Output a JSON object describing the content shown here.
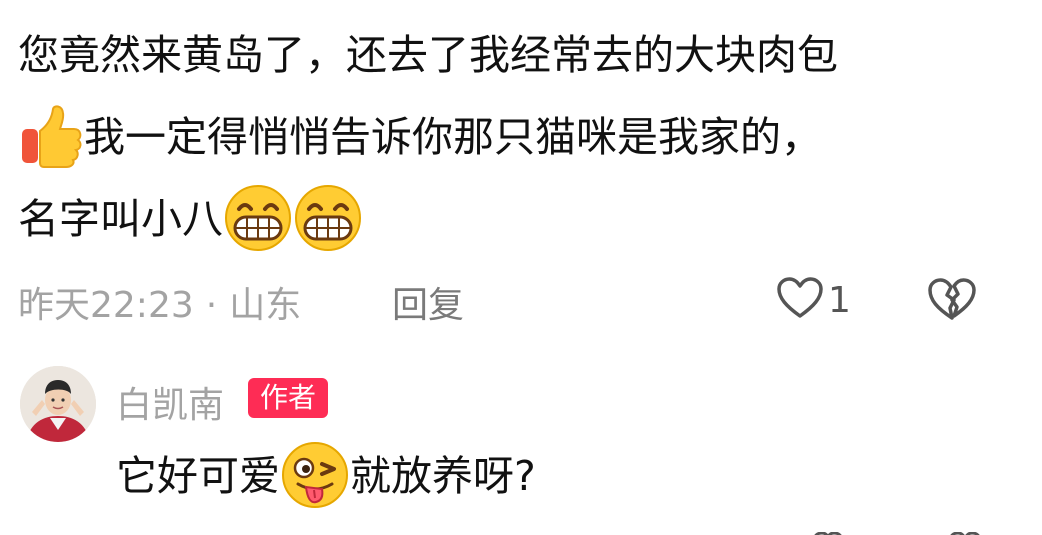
{
  "comment": {
    "line1": "您竟然来黄岛了，还去了我经常去的大块肉包",
    "line2_text": "我一定得悄悄告诉你那只猫咪是我家的，",
    "line3_text": "名字叫小八",
    "icons": [
      "thumbs-up-emoji",
      "grinning-emoji",
      "grinning-emoji"
    ]
  },
  "meta": {
    "time": "昨天22:23",
    "separator": "·",
    "location": "山东",
    "reply_label": "回复",
    "like_count": "1"
  },
  "author_reply": {
    "name": "白凯南",
    "badge": "作者",
    "text_before": "它好可爱",
    "text_after": "就放养呀?",
    "icons": [
      "winking-tongue-emoji"
    ]
  },
  "colors": {
    "text": "#111111",
    "meta": "#a3a3a3",
    "badge": "#fe2c55"
  }
}
